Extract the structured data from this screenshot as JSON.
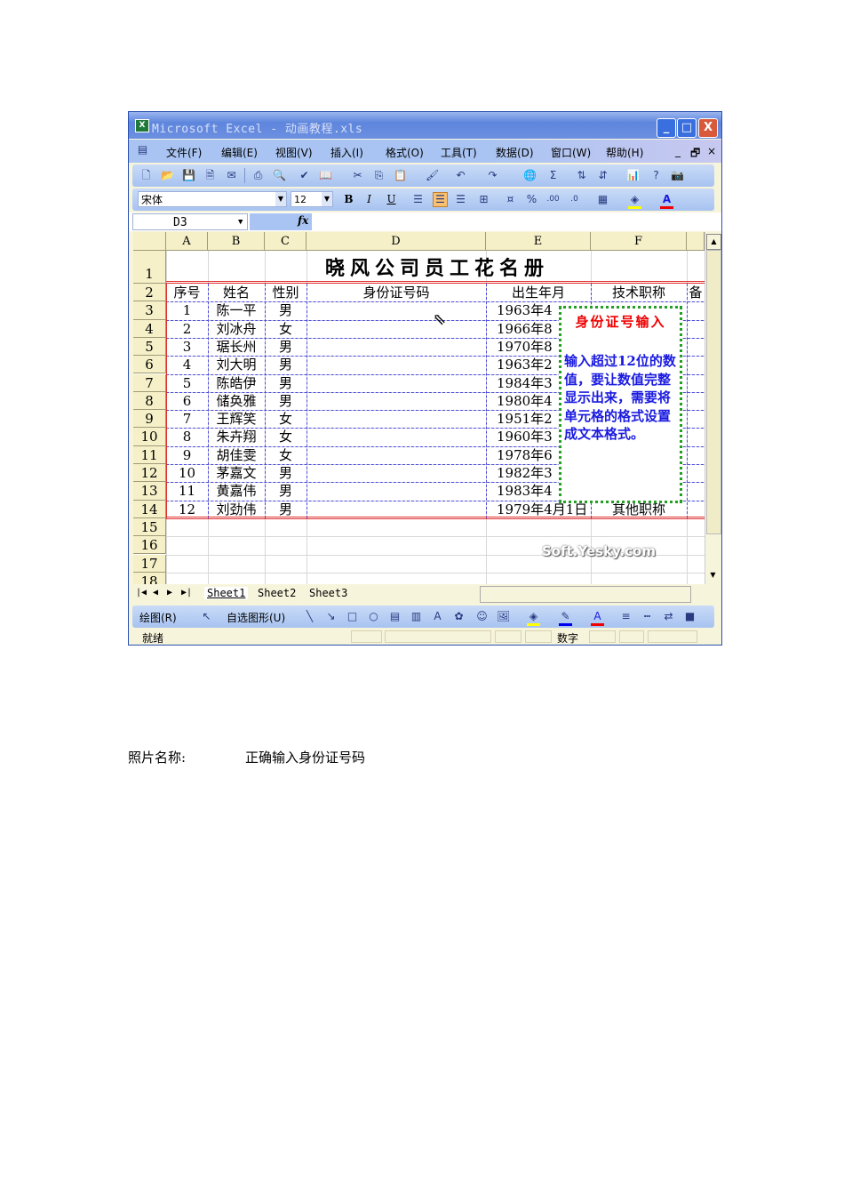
{
  "window": {
    "title": "Microsoft Excel - 动画教程.xls",
    "minimize": "_",
    "maximize": "□",
    "close": "X"
  },
  "menu": {
    "items": [
      "文件(F)",
      "编辑(E)",
      "视图(V)",
      "插入(I)",
      "格式(O)",
      "工具(T)",
      "数据(D)",
      "窗口(W)",
      "帮助(H)"
    ],
    "doc_min": "_",
    "doc_restore": "🗗",
    "doc_close": "×"
  },
  "format_toolbar": {
    "font": "宋体",
    "size": "12",
    "bold": "B",
    "italic": "I",
    "underline": "U",
    "percent": "%"
  },
  "formula_bar": {
    "cell_ref": "D3",
    "fx": "fx",
    "value": ""
  },
  "columns": [
    "A",
    "B",
    "C",
    "D",
    "E",
    "F"
  ],
  "row_numbers": [
    "1",
    "2",
    "3",
    "4",
    "5",
    "6",
    "7",
    "8",
    "9",
    "10",
    "11",
    "12",
    "13",
    "14",
    "15",
    "16",
    "17",
    "18"
  ],
  "sheet_title": "晓风公司员工花名册",
  "headers": [
    "序号",
    "姓名",
    "性别",
    "身份证号码",
    "出生年月",
    "技术职称",
    "备"
  ],
  "rows": [
    [
      "1",
      "陈一平",
      "男",
      "",
      "1963年4",
      ""
    ],
    [
      "2",
      "刘冰舟",
      "女",
      "",
      "1966年8",
      ""
    ],
    [
      "3",
      "琚长州",
      "男",
      "",
      "1970年8",
      ""
    ],
    [
      "4",
      "刘大明",
      "男",
      "",
      "1963年2",
      ""
    ],
    [
      "5",
      "陈皓伊",
      "男",
      "",
      "1984年3",
      ""
    ],
    [
      "6",
      "储奂雅",
      "男",
      "",
      "1980年4",
      ""
    ],
    [
      "7",
      "王辉笑",
      "女",
      "",
      "1951年2",
      ""
    ],
    [
      "8",
      "朱卉翔",
      "女",
      "",
      "1960年3",
      ""
    ],
    [
      "9",
      "胡佳雯",
      "女",
      "",
      "1978年6",
      ""
    ],
    [
      "10",
      "茅嘉文",
      "男",
      "",
      "1982年3",
      ""
    ],
    [
      "11",
      "黄嘉伟",
      "男",
      "",
      "1983年4",
      ""
    ],
    [
      "12",
      "刘劲伟",
      "男",
      "",
      "1979年4月1日",
      "其他职称"
    ]
  ],
  "callout": {
    "title": "身份证号输入",
    "body": "输入超过12位的数值，要让数值完整显示出来，需要将单元格的格式设置成文本格式。"
  },
  "watermark": "Soft.Yesky.com",
  "sheet_tabs": [
    "Sheet1",
    "Sheet2",
    "Sheet3"
  ],
  "draw_toolbar": {
    "draw": "绘图(R)",
    "autoshapes": "自选图形(U)"
  },
  "status": {
    "ready": "就绪",
    "mode": "数字"
  },
  "caption": {
    "label": "照片名称:",
    "value": "正确输入身份证号码"
  },
  "colors": {
    "title_text": "#e00000",
    "callout_text": "#1a1ae0",
    "callout_border": "#22a022",
    "grid_dash": "#4a4ae0",
    "table_border": "#e03030"
  }
}
